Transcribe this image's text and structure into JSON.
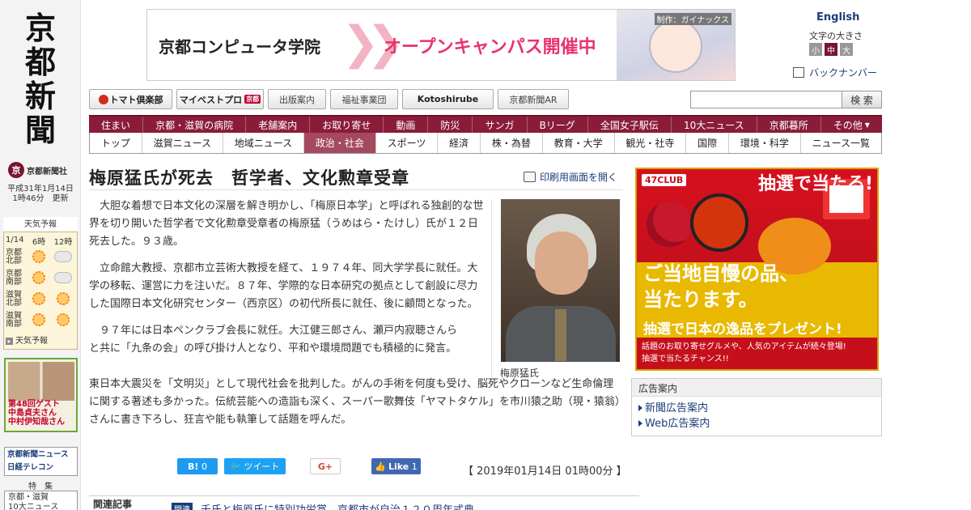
{
  "sidebar": {
    "logo": "京都新聞",
    "corp_name": "京都新聞社",
    "updated_date": "平成31年1月14日",
    "updated_time": "1時46分　更新",
    "weather": {
      "title": "天気予報",
      "date": "1/14",
      "time1": "6時",
      "time2": "12時",
      "regions": [
        {
          "name": "京都北部",
          "t6": "sun",
          "t12": "cloud"
        },
        {
          "name": "京都南部",
          "t6": "sun",
          "t12": "cloud"
        },
        {
          "name": "滋賀北部",
          "t6": "sun",
          "t12": "sun"
        },
        {
          "name": "滋賀南部",
          "t6": "sun",
          "t12": "sun"
        }
      ],
      "link": "天気予報"
    },
    "promo": {
      "line1": "第48回ゲスト",
      "line2": "中島貞夫さん",
      "line3": "中村伊知哉さん"
    },
    "nikkei": {
      "line1": "京都新聞ニュース",
      "line2": "日経テレコン"
    },
    "toku": "特　集",
    "news10": {
      "line1": "京都・滋賀",
      "line2": "10大ニュース"
    }
  },
  "banner": {
    "school": "京都コンピュータ学院",
    "campaign": "オープンキャンパス開催中",
    "credit": "制作：ガイナックス"
  },
  "header_tools": {
    "english": "English",
    "font_size_label": "文字の大きさ",
    "font_sizes": [
      "小",
      "中",
      "大"
    ],
    "back_number": "バックナンバー"
  },
  "toolbar": {
    "buttons": [
      "トマト倶楽部",
      "マイベストプロ",
      "出版案内",
      "福祉事業団",
      "Kotoshirube",
      "京都新聞AR"
    ],
    "best_pro_tag": "京都",
    "search_placeholder": "",
    "search_label": "検 索"
  },
  "nav_primary": [
    "住まい",
    "京都・滋賀の病院",
    "老舗案内",
    "お取り寄せ",
    "動画",
    "防災",
    "サンガ",
    "Bリーグ",
    "全国女子駅伝",
    "10大ニュース",
    "京都暮所",
    "その他"
  ],
  "nav_secondary": [
    "トップ",
    "滋賀ニュース",
    "地域ニュース",
    "政治・社会",
    "スポーツ",
    "経済",
    "株・為替",
    "教育・大学",
    "観光・社寺",
    "国際",
    "環境・科学",
    "ニュース一覧"
  ],
  "nav_secondary_active": "政治・社会",
  "article": {
    "headline": "梅原猛氏が死去　哲学者、文化勲章受章",
    "print_link": "印刷用画面を開く",
    "paragraphs": [
      "大胆な着想で日本文化の深層を解き明かし、「梅原日本学」と呼ばれる独創的な世界を切り開いた哲学者で文化勲章受章者の梅原猛（うめはら・たけし）氏が１２日死去した。９３歳。",
      "立命館大教授、京都市立芸術大教授を経て、１９７４年、同大学学長に就任。大学の移転、運営に力を注いだ。８７年、学際的な日本研究の拠点として創設に尽力した国際日本文化研究センター（西京区）の初代所長に就任、後に顧問となった。"
    ],
    "para3_line1": "９７年には日本ペンクラブ会長に就任。大江健三郎さん、瀬戸内寂聴さんら",
    "para3_line2": "と共に「九条の会」の呼び掛け人となり、平和や環境問題でも積極的に発言。",
    "para3_rest": "東日本大震災を「文明災」として現代社会を批判した。がんの手術を何度も受け、脳死やクローンなど生命倫理に関する著述も多かった。伝統芸能への造詣も深く、スーパー歌舞伎「ヤマトタケル」を市川猿之助（現・猿翁）さんに書き下ろし、狂言や能も執筆して話題を呼んだ。",
    "photo_caption": "梅原猛氏",
    "date": "【 2019年01月14日 01時00分 】"
  },
  "social": {
    "hatena_label": "B!",
    "hatena_count": "0",
    "tweet": "ツイート",
    "gplus": "G+",
    "like_label": "Like",
    "like_count": "1"
  },
  "related": {
    "label": "関連記事",
    "tag": "関連",
    "link": "千氏と梅原氏に特別功労賞　京都市が自治１２０周年式典"
  },
  "ad": {
    "club": "47CLUB",
    "win": "抽選で当たる!",
    "copy1": "ご当地自慢の品、",
    "copy2": "当たります。",
    "present": "抽選で日本の逸品をプレゼント!",
    "bottom1": "話題のお取り寄せグルメや、人気のアイテムが続々登場!",
    "bottom2": "抽選で当たるチャンス!!"
  },
  "ad_info": {
    "header": "広告案内",
    "links": [
      "新聞広告案内",
      "Web広告案内"
    ]
  }
}
